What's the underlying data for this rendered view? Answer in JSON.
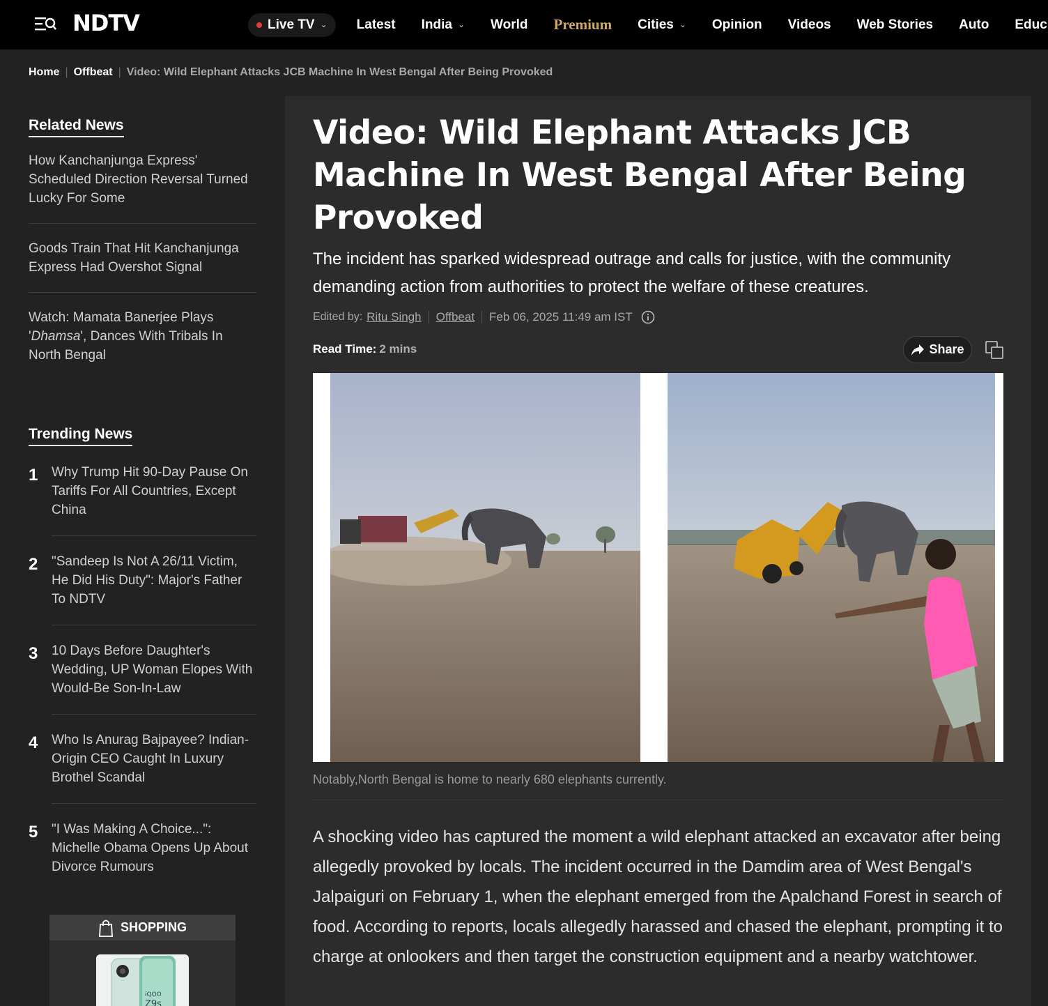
{
  "header": {
    "logo_text": "NDTV",
    "nav": [
      {
        "label": "Live TV",
        "dropdown": true,
        "live": true
      },
      {
        "label": "Latest"
      },
      {
        "label": "India",
        "dropdown": true
      },
      {
        "label": "World"
      },
      {
        "label": "Premium",
        "premium": true
      },
      {
        "label": "Cities",
        "dropdown": true
      },
      {
        "label": "Opinion"
      },
      {
        "label": "Videos"
      },
      {
        "label": "Web Stories"
      },
      {
        "label": "Auto"
      },
      {
        "label": "Educ"
      }
    ]
  },
  "breadcrumb": {
    "home": "Home",
    "section": "Offbeat",
    "current": "Video: Wild Elephant Attacks JCB Machine In West Bengal After Being Provoked"
  },
  "sidebar": {
    "related_title": "Related News",
    "related": [
      "How Kanchanjunga Express' Scheduled Direction Reversal Turned Lucky For Some",
      "Goods Train That Hit Kanchanjunga Express Had Overshot Signal",
      "Watch: Mamata Banerjee Plays 'Dhamsa', Dances With Tribals In North Bengal"
    ],
    "trending_title": "Trending News",
    "trending": [
      {
        "num": "1",
        "text": "Why Trump Hit 90-Day Pause On Tariffs For All Countries, Except China"
      },
      {
        "num": "2",
        "text": "\"Sandeep Is Not A 26/11 Victim, He Did His Duty\": Major's Father To NDTV"
      },
      {
        "num": "3",
        "text": "10 Days Before Daughter's Wedding, UP Woman Elopes With Would-Be Son-In-Law"
      },
      {
        "num": "4",
        "text": "Who Is Anurag Bajpayee? Indian-Origin CEO Caught In Luxury Brothel Scandal"
      },
      {
        "num": "5",
        "text": "\"I Was Making A Choice...\": Michelle Obama Opens Up About Divorce Rumours"
      }
    ],
    "shopping_label": "SHOPPING"
  },
  "article": {
    "headline": "Video: Wild Elephant Attacks JCB Machine In West Bengal After Being Provoked",
    "subhead": "The incident has sparked widespread outrage and calls for justice, with the community demanding action from authorities to protect the welfare of these creatures.",
    "edited_by_label": "Edited by:",
    "author": "Ritu Singh",
    "category": "Offbeat",
    "date": "Feb 06, 2025 11:49 am IST",
    "read_time_label": "Read Time:",
    "read_time": "2 mins",
    "share_label": "Share",
    "caption": "Notably,North Bengal is home to nearly 680 elephants currently.",
    "body": "A shocking video has captured the moment a wild elephant attacked an excavator after being allegedly provoked by locals. The incident occurred in the Damdim area of West Bengal's Jalpaiguri on February 1, when the elephant emerged from the Apalchand Forest in search of food. According to reports, locals allegedly harassed and chased the elephant, prompting it to charge at onlookers and then target the construction equipment and a nearby watchtower."
  },
  "colors": {
    "background": "#222222",
    "topbar": "#000000",
    "article_bg": "#2c2c2c",
    "premium": "#d0a96a",
    "live_dot": "#e43d3d"
  }
}
